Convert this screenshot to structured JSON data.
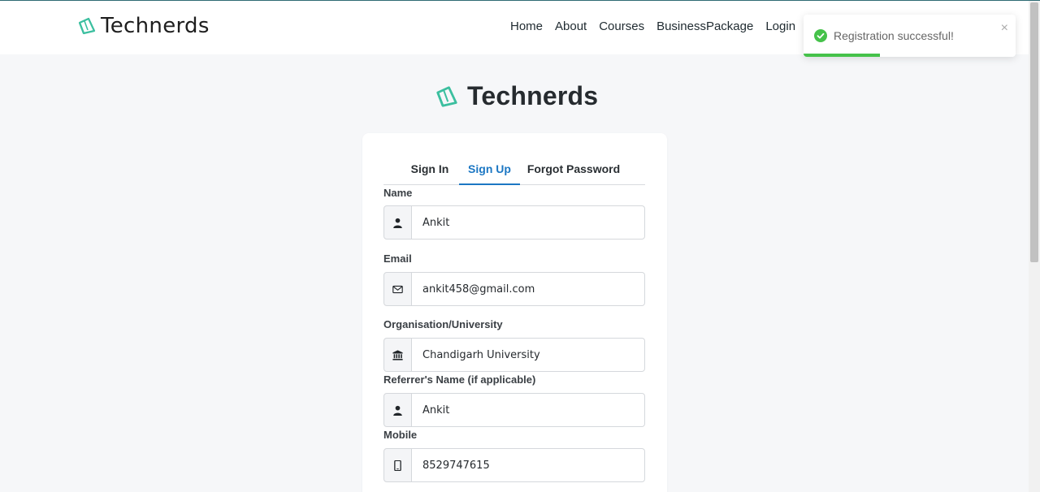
{
  "brand": {
    "name": "Technerds"
  },
  "nav": {
    "items": [
      "Home",
      "About",
      "Courses",
      "BusinessPackage",
      "Login"
    ]
  },
  "toast": {
    "message": "Registration successful!",
    "close": "×",
    "progress": 0.36
  },
  "page_logo": {
    "text": "Technerds"
  },
  "tabs": [
    {
      "label": "Sign In",
      "active": false
    },
    {
      "label": "Sign Up",
      "active": true
    },
    {
      "label": "Forgot Password",
      "active": false
    }
  ],
  "form": {
    "name": {
      "label": "Name",
      "value": "Ankit",
      "icon": "user-icon"
    },
    "email": {
      "label": "Email",
      "value": "ankit458@gmail.com",
      "icon": "envelope-icon"
    },
    "organisation": {
      "label": "Organisation/University",
      "value": "Chandigarh University",
      "icon": "building-icon"
    },
    "referrer": {
      "label": "Referrer's Name (if applicable)",
      "value": "Ankit",
      "icon": "user-icon"
    },
    "mobile": {
      "label": "Mobile",
      "value": "8529747615",
      "icon": "mobile-icon"
    }
  },
  "colors": {
    "accent": "#1c77c3",
    "brand_icon": "#3bbf9f",
    "toast_success": "#45c24a"
  }
}
